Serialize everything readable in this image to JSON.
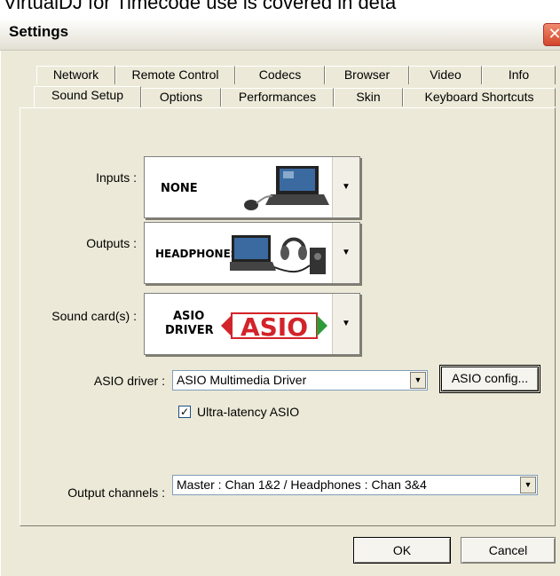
{
  "top_strip_text": "VirtualDJ for Timecode use is covered in deta",
  "window": {
    "title": "Settings",
    "close": "✕"
  },
  "tabs_row1": [
    "Network",
    "Remote Control",
    "Codecs",
    "Browser",
    "Video",
    "Info"
  ],
  "tabs_row2": [
    "Sound Setup",
    "Options",
    "Performances",
    "Skin",
    "Keyboard Shortcuts"
  ],
  "active_tab": "Sound Setup",
  "inputs": {
    "label": "Inputs :",
    "value": "NONE"
  },
  "outputs": {
    "label": "Outputs :",
    "value": "HEADPHONES"
  },
  "soundcard": {
    "label": "Sound card(s) :",
    "value_line1": "ASIO",
    "value_line2": "DRIVER",
    "logo": "ASIO"
  },
  "asio_driver": {
    "label": "ASIO driver :",
    "value": "ASIO Multimedia Driver",
    "config_button": "ASIO config..."
  },
  "ultra_latency": {
    "label": "Ultra-latency ASIO",
    "checked": true,
    "check": "✓"
  },
  "output_channels": {
    "label": "Output channels :",
    "value": "Master : Chan 1&2 / Headphones : Chan 3&4"
  },
  "buttons": {
    "ok": "OK",
    "cancel": "Cancel"
  },
  "icons": {
    "dropdown": "▼"
  },
  "colors": {
    "window_bg": "#ece9d8",
    "close_red": "#d2452a",
    "asio_red": "#d3232a",
    "asio_green": "#2e9b3a"
  }
}
